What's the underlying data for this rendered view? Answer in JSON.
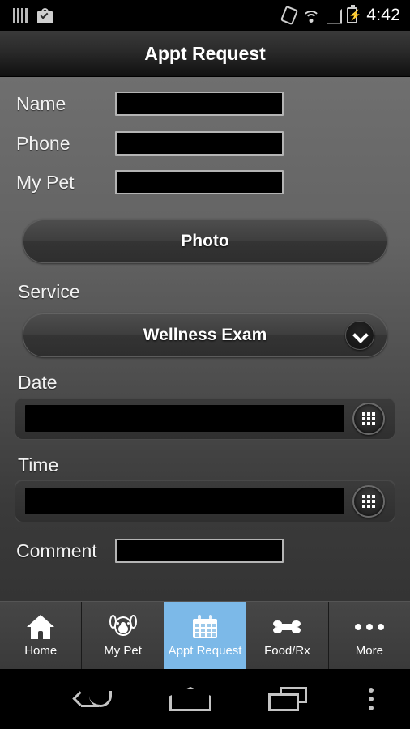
{
  "status_bar": {
    "time": "4:42",
    "left_icons": [
      "signal-bars-icon",
      "play-store-bag-icon"
    ],
    "right_icons": [
      "vibrate-icon",
      "wifi-icon",
      "cellular-signal-icon",
      "battery-charging-icon"
    ]
  },
  "title_bar": {
    "title": "Appt Request"
  },
  "form": {
    "fields": [
      {
        "label": "Name",
        "value": "",
        "placeholder": ""
      },
      {
        "label": "Phone",
        "value": "",
        "placeholder": ""
      },
      {
        "label": "My Pet",
        "value": "",
        "placeholder": ""
      }
    ],
    "photo_button": "Photo",
    "service_label": "Service",
    "service_selected": "Wellness Exam",
    "date_label": "Date",
    "date_value": "",
    "time_label": "Time",
    "time_value": "",
    "comment_label": "Comment",
    "comment_value": ""
  },
  "tabs": [
    {
      "label": "Home",
      "icon": "home-icon",
      "active": false
    },
    {
      "label": "My Pet",
      "icon": "dog-icon",
      "active": false
    },
    {
      "label": "Appt Request",
      "icon": "calendar-icon",
      "active": true
    },
    {
      "label": "Food/Rx",
      "icon": "bone-icon",
      "active": false
    },
    {
      "label": "More",
      "icon": "ellipsis-icon",
      "active": false
    }
  ],
  "nav_bar": {
    "buttons": [
      "back-icon",
      "home-icon",
      "recents-icon",
      "overflow-menu-icon"
    ]
  },
  "colors": {
    "accent": "#7cb9e8",
    "bg_top": "#6f6f6f",
    "bg_bottom": "#343434",
    "input_bg": "#000000",
    "input_border": "#b4b4b4"
  }
}
